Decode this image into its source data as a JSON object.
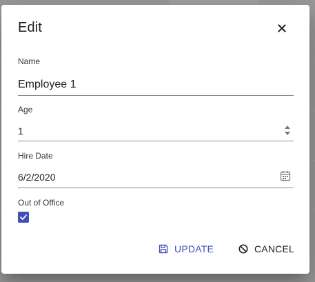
{
  "dialog": {
    "title": "Edit",
    "close_icon": "close-icon"
  },
  "fields": {
    "name": {
      "label": "Name",
      "value": "Employee 1"
    },
    "age": {
      "label": "Age",
      "value": "1"
    },
    "hire_date": {
      "label": "Hire Date",
      "value": "6/2/2020",
      "icon": "calendar-icon"
    },
    "out_of_office": {
      "label": "Out of Office",
      "checked": true
    }
  },
  "actions": {
    "update_label": "UPDATE",
    "update_icon": "save-icon",
    "cancel_label": "CANCEL",
    "cancel_icon": "cancel-icon"
  },
  "colors": {
    "accent": "#3f51b5",
    "text": "#212121",
    "overlay": "#9b9b9b"
  }
}
